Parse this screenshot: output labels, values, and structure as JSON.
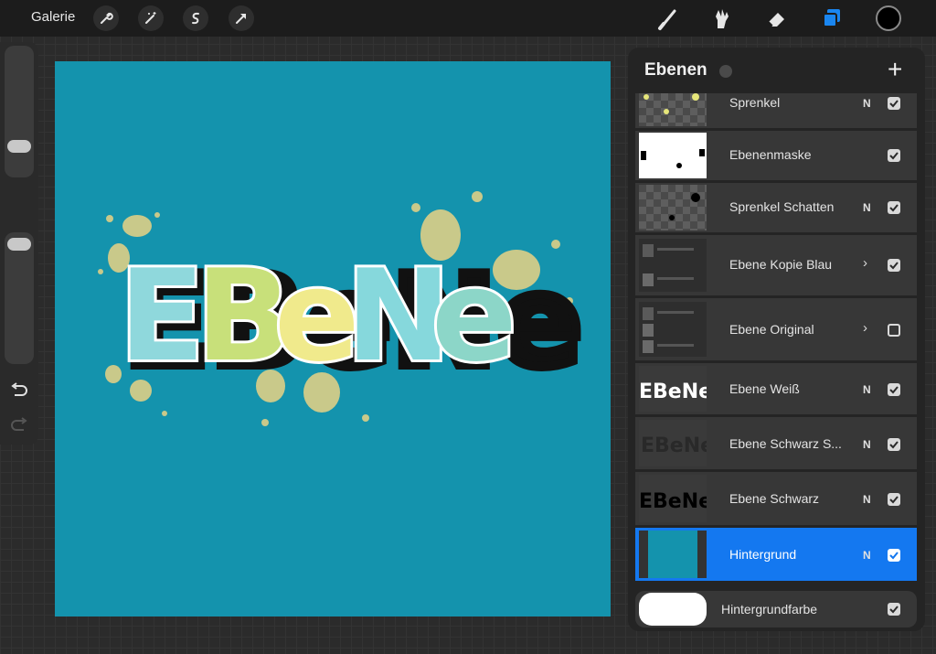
{
  "topbar": {
    "gallery_label": "Galerie",
    "left_tools": [
      "wrench-icon",
      "magic-wand-icon",
      "selection-icon",
      "transform-arrow-icon"
    ],
    "right_tools": [
      "brush-icon",
      "smudge-icon",
      "eraser-icon",
      "layers-icon"
    ],
    "active_tool": "layers-icon",
    "current_color": "#000000"
  },
  "sidebar": {
    "brush_size_level": 0.5,
    "opacity_level": 0.95,
    "undo_icon": "undo-icon",
    "redo_icon": "redo-icon"
  },
  "canvas": {
    "background_color": "#1493ad",
    "artwork_text": "EBeNe"
  },
  "layers_panel": {
    "title": "Ebenen",
    "add_icon": "plus-icon",
    "layers": [
      {
        "name": "Sprenkel",
        "mode": "N",
        "visible": true,
        "arrow": ""
      },
      {
        "name": "Ebenenmaske",
        "mode": "",
        "visible": true,
        "arrow": ""
      },
      {
        "name": "Sprenkel Schatten",
        "mode": "N",
        "visible": true,
        "arrow": ""
      },
      {
        "name": "Ebene Kopie Blau",
        "mode": "",
        "visible": true,
        "arrow": "›"
      },
      {
        "name": "Ebene Original",
        "mode": "",
        "visible": false,
        "arrow": "›"
      },
      {
        "name": "Ebene Weiß",
        "mode": "N",
        "visible": true,
        "arrow": "",
        "thumb_text": "EBeNe"
      },
      {
        "name": "Ebene Schwarz S...",
        "mode": "N",
        "visible": true,
        "arrow": "",
        "thumb_text": "EBeNe"
      },
      {
        "name": "Ebene Schwarz",
        "mode": "N",
        "visible": true,
        "arrow": "",
        "thumb_text": "EBeNe"
      },
      {
        "name": "Hintergrund",
        "mode": "N",
        "visible": true,
        "arrow": "",
        "selected": true
      }
    ],
    "background_color_layer": {
      "name": "Hintergrundfarbe",
      "visible": true,
      "color": "#ffffff"
    }
  }
}
